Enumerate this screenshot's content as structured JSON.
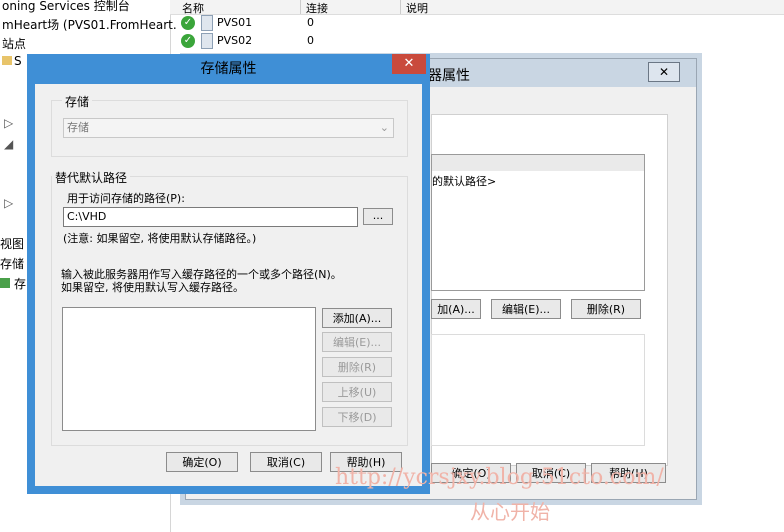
{
  "console": {
    "tree": [
      "oning Services 控制台",
      "mHeart场 (PVS01.FromHeart.",
      "站点",
      "S",
      "视图",
      "存储",
      "存"
    ],
    "columns": [
      "名称",
      "连接",
      "说明"
    ],
    "rows": [
      {
        "name": "PVS01",
        "connections": "0"
      },
      {
        "name": "PVS02",
        "connections": "0"
      }
    ]
  },
  "back_dialog": {
    "title": "器属性",
    "list_item": "的默认路径>",
    "add_label": "加(A)...",
    "edit_label": "编辑(E)...",
    "delete_label": "删除(R)",
    "ok_label": "确定(O)",
    "cancel_label": "取消(C)",
    "help_label": "帮助(H)",
    "close_glyph": "✕"
  },
  "dialog": {
    "title": "存储属性",
    "close_glyph": "✕",
    "storage_group_label": "存储",
    "storage_value": "存储",
    "alt_path_group_label": "替代默认路径",
    "access_path_label": "用于访问存储的路径(P):",
    "access_path_value": "C:\\VHD",
    "browse_label": "...",
    "note": "(注意: 如果留空, 将使用默认存储路径。)",
    "cache_instructions_1": "输入被此服务器用作写入缓存路径的一个或多个路径(N)。",
    "cache_instructions_2": "如果留空, 将使用默认写入缓存路径。",
    "add_label": "添加(A)...",
    "edit_label": "编辑(E)...",
    "delete_label": "删除(R)",
    "move_up_label": "上移(U)",
    "move_down_label": "下移(D)",
    "ok_label": "确定(O)",
    "cancel_label": "取消(C)",
    "help_label": "帮助(H)"
  },
  "watermark": {
    "url": "http://ycrsjxy.blog.51cto.com/",
    "slogan": "从心开始"
  },
  "colors": {
    "title_bar": "#3f8fd6",
    "close_button": "#c94a3c",
    "dialog_bg": "#f0f0f0",
    "watermark": "#f0b3a8"
  }
}
